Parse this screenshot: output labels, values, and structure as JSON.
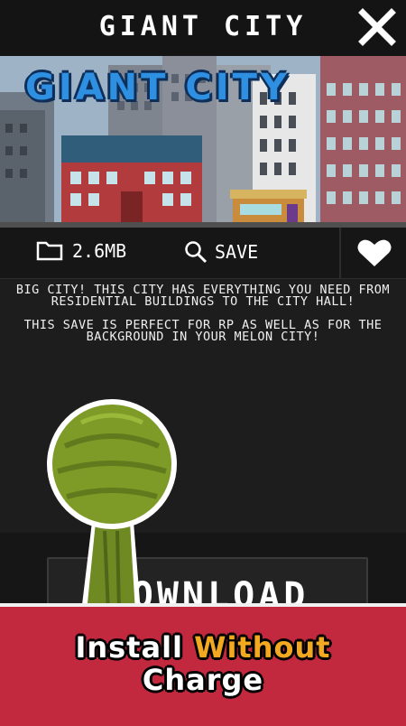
{
  "header": {
    "title": "GIANT CITY",
    "close_icon": "close-icon"
  },
  "banner": {
    "logo_text": "GIANT CITY"
  },
  "info": {
    "file_size": "2.6MB",
    "save_label": "SAVE",
    "icons": [
      "folder-icon",
      "search-icon",
      "heart-icon"
    ]
  },
  "description": {
    "para1": "BIG CITY! THIS CITY HAS EVERYTHING YOU NEED FROM RESIDENTIAL BUILDINGS TO THE CITY HALL!",
    "para2": "THIS SAVE IS PERFECT FOR RP AS WELL AS FOR THE BACKGROUND IN YOUR MELON CITY!"
  },
  "download": {
    "label": "DOWNLOAD"
  },
  "promo": {
    "line1_white": "Install",
    "line1_accent": "Without",
    "line2": "Charge"
  },
  "colors": {
    "promo_bg": "#c2293f",
    "accent": "#f2a91f",
    "melon": "#7e9a27",
    "logo_blue": "#2f8fe0"
  }
}
